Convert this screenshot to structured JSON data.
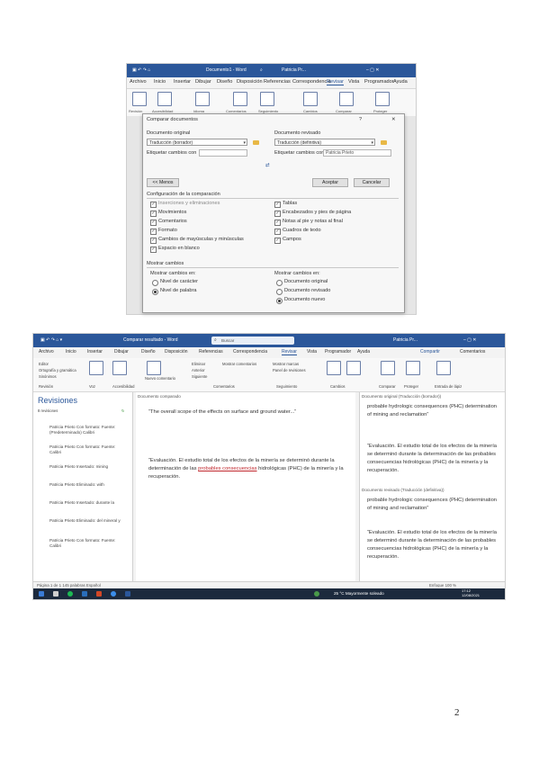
{
  "shot1": {
    "window_title": "Documento1 - Word",
    "user": "Patricia Pr...",
    "tabs": [
      "Archivo",
      "Inicio",
      "Insertar",
      "Dibujar",
      "Diseño",
      "Disposición",
      "Referencias",
      "Correspondencia",
      "Revisar",
      "Vista",
      "Programador",
      "Ayuda"
    ],
    "active_tab": "Revisar",
    "ribbon_labels": [
      "Revisión",
      "Accesibilidad",
      "Idioma",
      "Comentarios",
      "Seguimiento",
      "Cambios",
      "Comparar",
      "Proteger"
    ],
    "dialog": {
      "title": "Comparar documentos",
      "help": "?",
      "close": "✕",
      "original_label": "Documento original",
      "original_value": "Traducción (borrador)",
      "revised_label": "Documento revisado",
      "revised_value": "Traducción (definitiva)",
      "label_changes_left": "Etiquetar cambios con",
      "label_changes_right": "Etiquetar cambios con",
      "label_changes_right_value": "Patricia Prieto",
      "swap_icon": "⇄",
      "less_button": "<< Menos",
      "accept_button": "Aceptar",
      "cancel_button": "Cancelar",
      "comparison_settings": "Configuración de la comparación",
      "settings_left": [
        "Inserciones y eliminaciones",
        "Movimientos",
        "Comentarios",
        "Formato",
        "Cambios de mayúsculas y minúsculas",
        "Espacio en blanco"
      ],
      "settings_right": [
        "Tablas",
        "Encabezados y pies de página",
        "Notas al pie y notas al final",
        "Cuadros de texto",
        "Campos"
      ],
      "show_changes": "Mostrar cambios",
      "show_changes_at": "Mostrar cambios en:",
      "level_options": [
        "Nivel de carácter",
        "Nivel de palabra"
      ],
      "show_changes_in": "Mostrar cambios en:",
      "doc_options": [
        "Documento original",
        "Documento revisado",
        "Documento nuevo"
      ]
    }
  },
  "shot2": {
    "window_title": "Comparar resultado - Word",
    "search_placeholder": "Buscar",
    "user": "Patricia Pr...",
    "tabs": [
      "Archivo",
      "Inicio",
      "Insertar",
      "Dibujar",
      "Diseño",
      "Disposición",
      "Referencias",
      "Correspondencia",
      "Revisar",
      "Vista",
      "Programador",
      "Ayuda"
    ],
    "active_tab": "Revisar",
    "compartir": "Compartir",
    "comentarios": "Comentarios",
    "ribbon_groups": [
      "Revisión",
      "Voz",
      "Accesibilidad",
      "Idioma",
      "Comentarios",
      "Seguimiento",
      "Cambios",
      "Comparar",
      "Proteger",
      "Entrada de lápiz",
      "CV"
    ],
    "ribbon_small": [
      "Editor",
      "Ortografía y gramática",
      "Sinónimos",
      "Contar palabras",
      "Nuevo comentario",
      "Eliminar",
      "Anterior",
      "Siguiente",
      "Mostrar comentarios",
      "Control de cambios",
      "Mostrar marcas",
      "Panel de revisiones",
      "Aceptar",
      "Rechazar",
      "Comparar",
      "Restringir edición",
      "Ocultar entrada de lápiz",
      "Iniciar entrada de lápiz"
    ],
    "revisions_title": "Revisiones",
    "revisions_count": "8 revisiones",
    "revisions": [
      "Patricia Prieto Con formato: Fuente: (Predeterminado) Calibri",
      "Patricia Prieto Con formato: Fuente: Calibri",
      "Patricia Prieto Insertado: mining",
      "Patricia Prieto Eliminado: with",
      "Patricia Prieto Insertado: durante la",
      "Patricia Prieto Eliminado: del mineral y",
      "Patricia Prieto Con formato: Fuente: Calibri"
    ],
    "compared_header": "Documento comparado",
    "original_header": "Documento original (Traducción (borrador))",
    "revised_header": "Documento revisado (Traducción (definitiva))",
    "p1": "“The overall scope of the effects on surface and ground water...”",
    "p2_before": "“Evaluación. El estudio total de los efectos de la minería se determinó durante la determinación de las ",
    "p2_red": "probables consecuencias",
    "p2_after": " hidrológicas (PHC) de la minería y la recuperación.",
    "right1": "probable hydrologic consequences (PHC) determination of mining and reclamation”",
    "right2": "“Evaluación. El estudio total de los efectos de la minería se determinó durante la determinación de las probables consecuencias hidrológicas (PHC) de la minería y la recuperación.",
    "right3": "probable hydrologic consequences (PHC) determination of mining and reclamation”",
    "right4": "“Evaluación. El estudio total de los efectos de la minería se determinó durante la determinación de las probables consecuencias hidrológicas (PHC) de la minería y la recuperación.",
    "status_left": "Página 1 de 1   145 palabras   Español",
    "status_right": "Enfoque   100 %",
    "taskbar_weather": "25 °C  Mayormente soleado",
    "taskbar_time": "17:12",
    "taskbar_date": "12/08/2021"
  },
  "page_number": "2"
}
